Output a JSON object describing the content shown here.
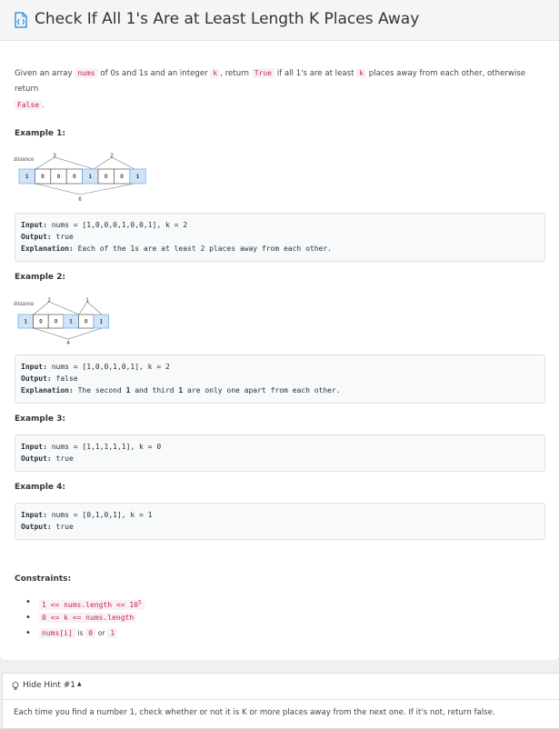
{
  "title": "Check If All 1's Are at Least Length K Places Away",
  "description": {
    "p1": "Given an array ",
    "c1": "nums",
    "p2": " of 0s and 1s and an integer ",
    "c2": "k",
    "p3": ", return ",
    "c3": "True",
    "p4": " if all 1's are at least ",
    "c4": "k",
    "p5": " places away from each other, otherwise return",
    "c5": "False",
    "p6": "."
  },
  "examples": [
    {
      "title": "Example 1:",
      "diagram": {
        "label": "distance",
        "cells": [
          "1",
          "0",
          "0",
          "0",
          "1",
          "0",
          "0",
          "1"
        ],
        "top_distances": [
          "3",
          "2"
        ],
        "bottom_distance": "6"
      },
      "input_label": "Input:",
      "input": " nums = [1,0,0,0,1,0,0,1], k = 2",
      "output_label": "Output:",
      "output": " true",
      "explanation_label": "Explanation:",
      "explanation": " Each of the 1s are at least 2 places away from each other."
    },
    {
      "title": "Example 2:",
      "diagram": {
        "label": "distance",
        "cells": [
          "1",
          "0",
          "0",
          "1",
          "0",
          "1"
        ],
        "top_distances": [
          "2",
          "1"
        ],
        "bottom_distance": "4"
      },
      "input_label": "Input:",
      "input": " nums = [1,0,0,1,0,1], k = 2",
      "output_label": "Output:",
      "output": " false",
      "explanation_label": "Explanation:",
      "explanation_a": " The second ",
      "explanation_b": "1",
      "explanation_c": " and third ",
      "explanation_d": "1",
      "explanation_e": " are only one apart from each other."
    },
    {
      "title": "Example 3:",
      "input_label": "Input:",
      "input": " nums = [1,1,1,1,1], k = 0",
      "output_label": "Output:",
      "output": " true"
    },
    {
      "title": "Example 4:",
      "input_label": "Input:",
      "input": " nums = [0,1,0,1], k = 1",
      "output_label": "Output:",
      "output": " true"
    }
  ],
  "constraints": {
    "title": "Constraints:",
    "c1_a": "1 <= nums.length <= 10",
    "c1_sup": "5",
    "c2": "0 <= k <= nums.length",
    "c3_a": "nums[i]",
    "c3_b": " is ",
    "c3_c": "0",
    "c3_d": " or ",
    "c3_e": "1"
  },
  "hint": {
    "label": "Hide Hint #1",
    "arrow": "▲",
    "text": "Each time you find a number 1, check whether or not it is K or more places away from the next one. If it's not, return false."
  },
  "colors": {
    "accent": "#1e88e5",
    "cell_one_fill": "#cfe4fb",
    "code_text": "#c7254e"
  }
}
